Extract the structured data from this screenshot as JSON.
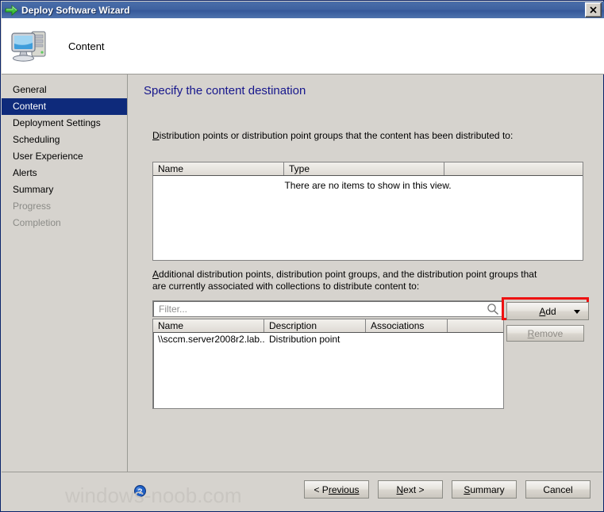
{
  "window": {
    "title": "Deploy Software Wizard",
    "close_label": "✕",
    "title_icon": "green-arrow-icon",
    "header_icon": "computer-icon",
    "header_title": "Content"
  },
  "sidebar": {
    "items": [
      {
        "label": "General",
        "state": "normal"
      },
      {
        "label": "Content",
        "state": "selected"
      },
      {
        "label": "Deployment Settings",
        "state": "normal"
      },
      {
        "label": "Scheduling",
        "state": "normal"
      },
      {
        "label": "User Experience",
        "state": "normal"
      },
      {
        "label": "Alerts",
        "state": "normal"
      },
      {
        "label": "Summary",
        "state": "normal"
      },
      {
        "label": "Progress",
        "state": "disabled"
      },
      {
        "label": "Completion",
        "state": "disabled"
      }
    ]
  },
  "main": {
    "heading": "Specify the content destination",
    "distributed_label_prefix": "D",
    "distributed_label_rest": "istribution points or distribution point groups that the content has been distributed to:",
    "distributed_table": {
      "columns": [
        "Name",
        "Type",
        ""
      ],
      "rows": [],
      "empty_message": "There are no items to show in this view."
    },
    "additional_label_prefix": "A",
    "additional_label_rest": "dditional distribution points, distribution point groups, and the distribution point groups that are currently associated with collections to distribute content to:",
    "filter": {
      "placeholder": "Filter...",
      "value": "",
      "icon": "search-icon"
    },
    "additional_table": {
      "columns": [
        "Name",
        "Description",
        "Associations",
        ""
      ],
      "rows": [
        {
          "name": "\\\\sccm.server2008r2.lab...",
          "description": "Distribution point",
          "associations": ""
        }
      ]
    },
    "add_button": {
      "label_prefix": "A",
      "label_rest": "dd",
      "has_dropdown": true,
      "highlighted": true,
      "highlight_color": "#ee1111"
    },
    "remove_button": {
      "label_prefix": "R",
      "label_rest": "emove",
      "disabled": true
    }
  },
  "footer": {
    "help_icon": "help-icon",
    "watermark": "windows-noob.com",
    "buttons": [
      {
        "label_prefix": "< P",
        "label_rest": "revious",
        "accesskey": "P",
        "name": "previous"
      },
      {
        "label_prefix": "N",
        "label_rest": "ext >",
        "accesskey": "N",
        "name": "next"
      },
      {
        "label_prefix": "S",
        "label_rest": "ummary",
        "accesskey": "S",
        "name": "summary"
      },
      {
        "label_prefix": "",
        "label_rest": "Cancel",
        "accesskey": "",
        "name": "cancel"
      }
    ]
  }
}
